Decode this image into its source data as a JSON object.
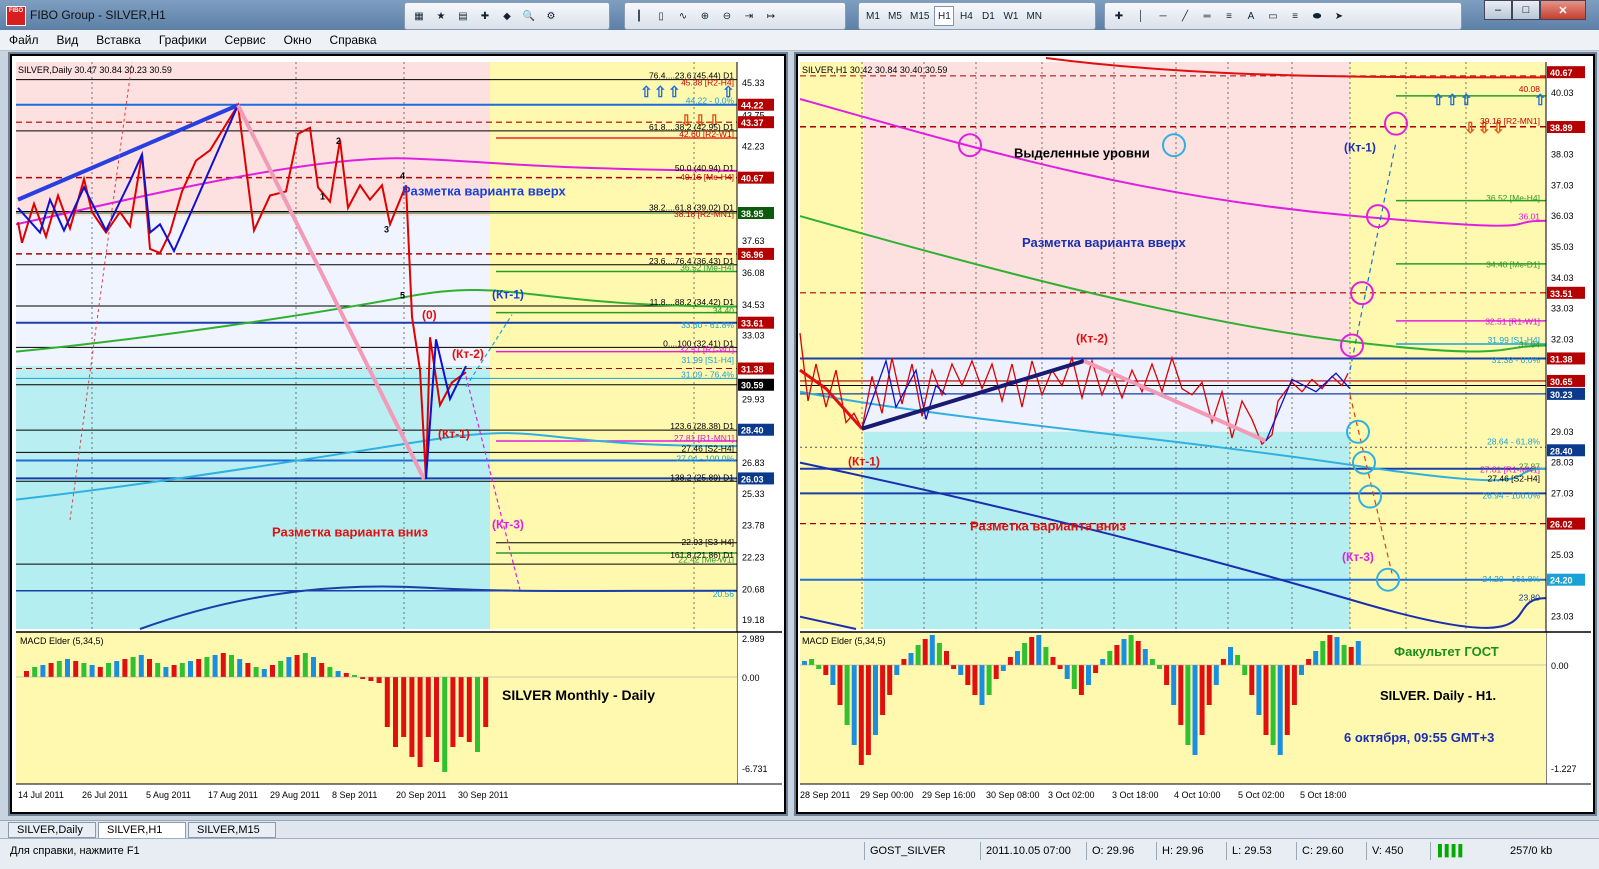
{
  "window": {
    "title": "FIBO Group - SILVER,H1",
    "app_icon_text": "FIBO"
  },
  "menu": [
    "Файл",
    "Вид",
    "Вставка",
    "Графики",
    "Сервис",
    "Окно",
    "Справка"
  ],
  "timeframes": [
    "M1",
    "M5",
    "M15",
    "H1",
    "H4",
    "D1",
    "W1",
    "MN"
  ],
  "active_timeframe": "H1",
  "left_chart": {
    "header": "SILVER,Daily  30.47 30.84 30.23 30.59",
    "price_labels": [
      {
        "text": "45.33",
        "price": 45.33
      },
      {
        "text": "43.75",
        "price": 43.75
      },
      {
        "text": "42.23",
        "price": 42.23
      },
      {
        "text": "39.10",
        "price": 39.1
      },
      {
        "text": "37.63",
        "price": 37.63
      },
      {
        "text": "36.08",
        "price": 36.08
      },
      {
        "text": "34.53",
        "price": 34.53
      },
      {
        "text": "33.03",
        "price": 33.03
      },
      {
        "text": "29.93",
        "price": 29.93
      },
      {
        "text": "26.83",
        "price": 26.83
      },
      {
        "text": "25.33",
        "price": 25.33
      },
      {
        "text": "23.78",
        "price": 23.78
      },
      {
        "text": "22.23",
        "price": 22.23
      },
      {
        "text": "20.68",
        "price": 20.68
      },
      {
        "text": "19.18",
        "price": 19.18
      }
    ],
    "tagged_prices": [
      {
        "text": "44.22",
        "price": 44.22,
        "bg": "#b40000"
      },
      {
        "text": "43.37",
        "price": 43.37,
        "bg": "#b40000"
      },
      {
        "text": "40.67",
        "price": 40.67,
        "bg": "#b40000"
      },
      {
        "text": "38.95",
        "price": 38.95,
        "bg": "#0c5a0c"
      },
      {
        "text": "36.96",
        "price": 36.96,
        "bg": "#b40000"
      },
      {
        "text": "33.61",
        "price": 33.61,
        "bg": "#b40000"
      },
      {
        "text": "31.38",
        "price": 31.38,
        "bg": "#b40000"
      },
      {
        "text": "30.59",
        "price": 30.59,
        "bg": "#000000"
      },
      {
        "text": "28.40",
        "price": 28.4,
        "bg": "#0b3a8c"
      },
      {
        "text": "26.03",
        "price": 26.03,
        "bg": "#0b3a8c"
      }
    ],
    "level_texts": [
      {
        "text": "76.4....23.6 (45.44) D1",
        "price": 45.44,
        "color": "#000"
      },
      {
        "text": "45.38 [R2-H4]",
        "price": 45.1,
        "color": "#c00"
      },
      {
        "text": "44.22 - 0.0%",
        "price": 44.22,
        "color": "#19a2d6"
      },
      {
        "text": "61.8....38.2 (42.95) D1",
        "price": 42.95,
        "color": "#000"
      },
      {
        "text": "42.60 [R2-W1]",
        "price": 42.6,
        "color": "#c00"
      },
      {
        "text": "50.0 (40.94) D1",
        "price": 40.94,
        "color": "#000"
      },
      {
        "text": "40.16 [Me-H4]",
        "price": 40.5,
        "color": "#c00"
      },
      {
        "text": "38.2....61.8 (39.02) D1",
        "price": 39.02,
        "color": "#000"
      },
      {
        "text": "38.18 [R2-MN1]",
        "price": 38.7,
        "color": "#c00"
      },
      {
        "text": "23.6....76.4 (36.43) D1",
        "price": 36.43,
        "color": "#000"
      },
      {
        "text": "36.52 [Me-H4]",
        "price": 36.1,
        "color": "#2a9a2a"
      },
      {
        "text": "11.8....88.2 (34.42) D1",
        "price": 34.42,
        "color": "#000"
      },
      {
        "text": "34.40",
        "price": 34.0,
        "color": "#2a9a2a"
      },
      {
        "text": "33.60 - 61.8%",
        "price": 33.3,
        "color": "#19a2d6"
      },
      {
        "text": "0....100 (32.41) D1",
        "price": 32.41,
        "color": "#000"
      },
      {
        "text": "32.51 [R1-W1]",
        "price": 32.1,
        "color": "#d818d8"
      },
      {
        "text": "31.99 [S1-H4]",
        "price": 31.6,
        "color": "#19a2d6"
      },
      {
        "text": "31.09 - 76.4%",
        "price": 30.9,
        "color": "#19a2d6"
      },
      {
        "text": "123.6 (28.38) D1",
        "price": 28.38,
        "color": "#000"
      },
      {
        "text": "27.81 [R1-MN1]",
        "price": 27.8,
        "color": "#d818d8"
      },
      {
        "text": "27.46 [S2-H4]",
        "price": 27.3,
        "color": "#000"
      },
      {
        "text": "27.04 - 100.0%",
        "price": 26.8,
        "color": "#19a2d6"
      },
      {
        "text": "138.2 (25.89) D1",
        "price": 25.89,
        "color": "#000"
      },
      {
        "text": "22.93 [S3-H4]",
        "price": 22.75,
        "color": "#000"
      },
      {
        "text": "161.8 (21.86) D1",
        "price": 22.1,
        "color": "#000"
      },
      {
        "text": "22.42 [Me-W1]",
        "price": 21.9,
        "color": "#2a9a2a"
      },
      {
        "text": "20.56",
        "price": 20.2,
        "color": "#19a2d6"
      }
    ],
    "annotations": {
      "up": "Разметка варианта вверх",
      "down": "Разметка варианта вниз",
      "kt1_blue": "(Кт-1)",
      "zero": "(0)",
      "kt2": "(Кт-2)",
      "kt1_red": "(Кт-1)",
      "kt3": "(Кт-3)",
      "w1": "1",
      "w2": "2",
      "w3": "3",
      "w4": "4",
      "w5": "5"
    },
    "macd_label": "MACD Elder (5,34,5)",
    "macd_values": {
      "top": "2.989",
      "zero": "0.00",
      "bottom": "-6.731"
    },
    "macd_caption": "SILVER  Monthly - Daily",
    "date_labels": [
      "14 Jul 2011",
      "26 Jul 2011",
      "5 Aug 2011",
      "17 Aug 2011",
      "29 Aug 2011",
      "8 Sep 2011",
      "20 Sep 2011",
      "30 Sep 2011"
    ]
  },
  "right_chart": {
    "header": "SILVER,H1  30.42 30.84 30.40 30.59",
    "price_labels": [
      {
        "text": "40.03",
        "price": 40.03
      },
      {
        "text": "38.03",
        "price": 38.03
      },
      {
        "text": "37.03",
        "price": 37.03
      },
      {
        "text": "36.03",
        "price": 36.03
      },
      {
        "text": "35.03",
        "price": 35.03
      },
      {
        "text": "34.03",
        "price": 34.03
      },
      {
        "text": "33.03",
        "price": 33.03
      },
      {
        "text": "32.03",
        "price": 32.03
      },
      {
        "text": "29.03",
        "price": 29.03
      },
      {
        "text": "28.03",
        "price": 28.03
      },
      {
        "text": "27.03",
        "price": 27.03
      },
      {
        "text": "25.03",
        "price": 25.03
      },
      {
        "text": "23.03",
        "price": 23.03
      }
    ],
    "tagged_prices": [
      {
        "text": "40.67",
        "price": 40.67,
        "bg": "#b40000"
      },
      {
        "text": "38.89",
        "price": 38.89,
        "bg": "#b40000"
      },
      {
        "text": "33.51",
        "price": 33.51,
        "bg": "#b40000"
      },
      {
        "text": "31.38",
        "price": 31.38,
        "bg": "#b40000"
      },
      {
        "text": "30.65",
        "price": 30.65,
        "bg": "#b40000"
      },
      {
        "text": "30.23",
        "price": 30.23,
        "bg": "#0b3a8c"
      },
      {
        "text": "28.40",
        "price": 28.4,
        "bg": "#0b3a8c"
      },
      {
        "text": "26.02",
        "price": 26.02,
        "bg": "#b40000"
      },
      {
        "text": "24.20",
        "price": 24.2,
        "bg": "#19a2d6"
      }
    ],
    "level_texts": [
      {
        "text": "40.08",
        "price": 40.0,
        "color": "#c00"
      },
      {
        "text": "39.16 [R2-MN1]",
        "price": 38.95,
        "color": "#c00"
      },
      {
        "text": "36.52 [Me-H4]",
        "price": 36.45,
        "color": "#2a9a2a"
      },
      {
        "text": "36.01",
        "price": 35.85,
        "color": "#d818d8"
      },
      {
        "text": "34.40 [Me-D1]",
        "price": 34.3,
        "color": "#2a9a2a"
      },
      {
        "text": "32.51 [R1-W1]",
        "price": 32.45,
        "color": "#d818d8"
      },
      {
        "text": "31.99 [S1-H4]",
        "price": 31.85,
        "color": "#19a2d6"
      },
      {
        "text": "31.94",
        "price": 31.7,
        "color": "#2a9a2a"
      },
      {
        "text": "31.38 - 0.0%",
        "price": 31.2,
        "color": "#19a2d6"
      },
      {
        "text": "28.64 - 61.8%",
        "price": 28.55,
        "color": "#19a2d6"
      },
      {
        "text": "27.87",
        "price": 27.75,
        "color": "#2a9a2a"
      },
      {
        "text": "27.81 [R1-MN1]",
        "price": 27.65,
        "color": "#d818d8"
      },
      {
        "text": "27.46 [S2-H4]",
        "price": 27.35,
        "color": "#000"
      },
      {
        "text": "26.94 - 100.0%",
        "price": 26.8,
        "color": "#19a2d6"
      },
      {
        "text": "24.20 - 161.8%",
        "price": 24.1,
        "color": "#19a2d6"
      },
      {
        "text": "23.80",
        "price": 23.5,
        "color": "#0b3a8c"
      }
    ],
    "annotations": {
      "levels": "Выделенные уровни",
      "up": "Разметка варианта вверх",
      "down": "Разметка варианта вниз",
      "kt1_blue": "(Кт-1)",
      "kt2": "(Кт-2)",
      "kt1_red": "(Кт-1)",
      "kt3": "(Кт-3)"
    },
    "macd_label": "MACD Elder (5,34,5)",
    "macd_values": {
      "zero": "0.00",
      "bottom": "-1.227"
    },
    "macd_caption_1": "Факультет ГОСТ",
    "macd_caption_2": "SILVER. Daily - H1.",
    "macd_caption_3": "6 октября, 09:55 GMT+3",
    "date_labels": [
      "28 Sep 2011",
      "29 Sep 00:00",
      "29 Sep 16:00",
      "30 Sep 08:00",
      "3 Oct 02:00",
      "3 Oct 18:00",
      "4 Oct 10:00",
      "5 Oct 02:00",
      "5 Oct 18:00"
    ]
  },
  "tabs": [
    {
      "label": "SILVER,Daily",
      "active": false
    },
    {
      "label": "SILVER,H1",
      "active": true
    },
    {
      "label": "SILVER,M15",
      "active": false
    }
  ],
  "status": {
    "help": "Для справки, нажмите F1",
    "profile": "GOST_SILVER",
    "datetime": "2011.10.05 07:00",
    "open": "O: 29.96",
    "high": "H: 29.96",
    "low": "L: 29.53",
    "close": "C: 29.60",
    "volume": "V: 450",
    "traffic": "257/0 kb"
  },
  "colors": {
    "pink_zone": "#fde0e0",
    "blue_zone": "#b4eef0",
    "yellow": "#fff9b0",
    "red": "#e00000",
    "blue": "#1010d0",
    "magenta": "#e020e0",
    "green": "#30b030",
    "cyan": "#30b0e0"
  }
}
